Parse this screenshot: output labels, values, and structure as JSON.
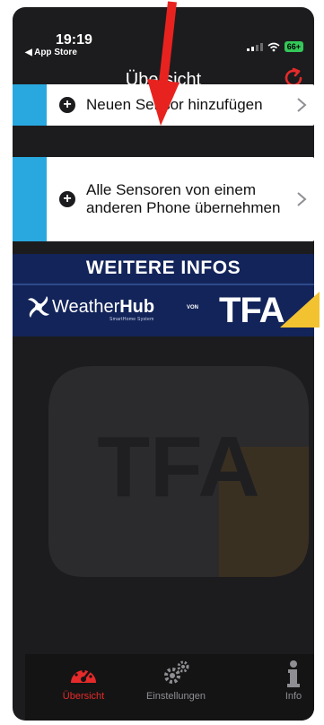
{
  "status_bar": {
    "time": "19:19",
    "back_app": "◀ App Store",
    "battery": "66+"
  },
  "nav": {
    "title": "Übersicht",
    "refresh_icon": "refresh-icon"
  },
  "menu": {
    "items": [
      {
        "label": "Neuen Sensor hinzufügen",
        "icon": "plus-circle-icon"
      },
      {
        "label": "Alle Sensoren von einem anderen Phone übernehmen",
        "icon": "plus-circle-icon"
      }
    ]
  },
  "banner": {
    "title": "WEITERE INFOS",
    "weather": "Weather",
    "hub": "Hub",
    "weatherhub_sub": "SmartHome System",
    "von": "VON",
    "tfa": "TFA"
  },
  "watermark": {
    "text": "TFA"
  },
  "tabbar": {
    "tabs": [
      {
        "label": "Übersicht",
        "icon": "gauge-icon",
        "active": true
      },
      {
        "label": "Einstellungen",
        "icon": "gears-icon",
        "active": false
      },
      {
        "label": "Info",
        "icon": "info-icon",
        "active": false
      }
    ]
  },
  "colors": {
    "accent_blue": "#29a8e0",
    "active_red": "#e62a2a",
    "banner_navy": "#13245a",
    "tfa_yellow": "#f2c230",
    "arrow_red": "#e8231f"
  }
}
